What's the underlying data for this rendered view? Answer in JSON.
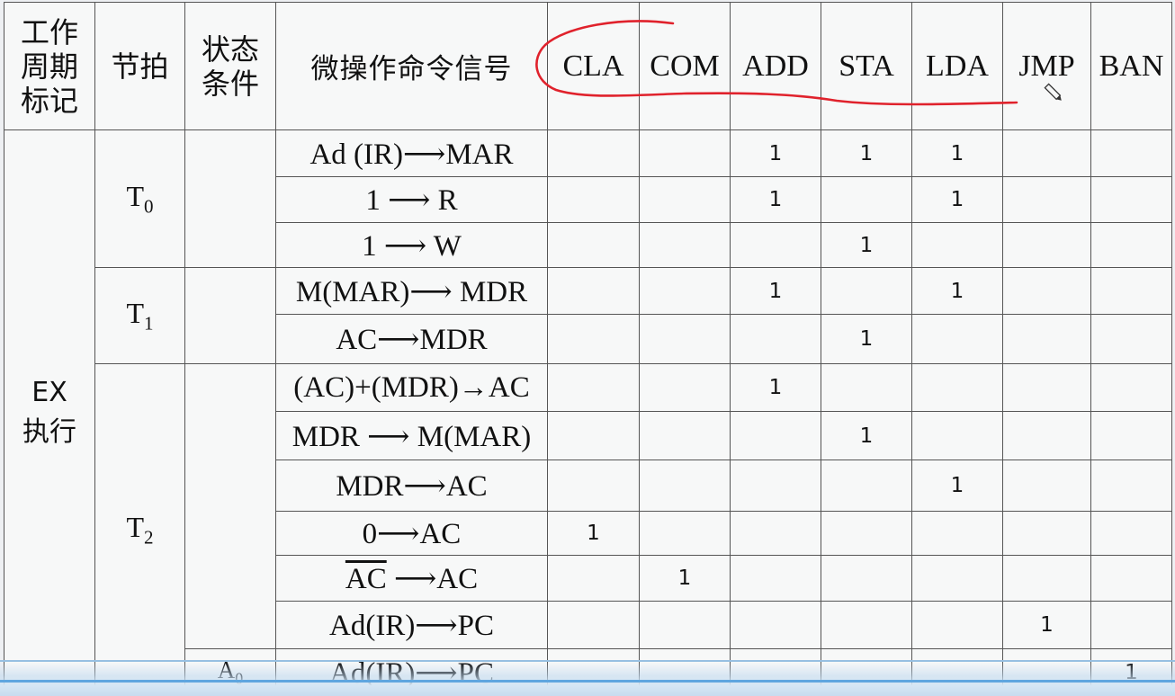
{
  "header": {
    "cycle_label": "工作\n周期\n标记",
    "beat_label": "节拍",
    "condition_label": "状态\n条件",
    "signal_label": "微操作命令信号",
    "ops": [
      "CLA",
      "COM",
      "ADD",
      "STA",
      "LDA",
      "JMP",
      "BAN"
    ]
  },
  "stage_label": "EX\n执行",
  "beats": {
    "t0": {
      "main": "T",
      "sub": "0"
    },
    "t1": {
      "main": "T",
      "sub": "1"
    },
    "t2": {
      "main": "T",
      "sub": "2"
    }
  },
  "condition_a0": {
    "main": "A",
    "sub": "0"
  },
  "rows": [
    {
      "signal": "Ad (IR)⟶MAR",
      "marks": [
        "",
        "",
        "1",
        "1",
        "1",
        "",
        ""
      ]
    },
    {
      "signal": "1 ⟶ R",
      "marks": [
        "",
        "",
        "1",
        "",
        "1",
        "",
        ""
      ]
    },
    {
      "signal": "1 ⟶ W",
      "marks": [
        "",
        "",
        "",
        "1",
        "",
        "",
        ""
      ]
    },
    {
      "signal": "M(MAR)⟶ MDR",
      "marks": [
        "",
        "",
        "1",
        "",
        "1",
        "",
        ""
      ]
    },
    {
      "signal": "AC⟶MDR",
      "marks": [
        "",
        "",
        "",
        "1",
        "",
        "",
        ""
      ]
    },
    {
      "signal": "(AC)+(MDR)→AC",
      "marks": [
        "",
        "",
        "1",
        "",
        "",
        "",
        ""
      ]
    },
    {
      "signal": "MDR ⟶ M(MAR)",
      "marks": [
        "",
        "",
        "",
        "1",
        "",
        "",
        ""
      ]
    },
    {
      "signal": "MDR⟶AC",
      "marks": [
        "",
        "",
        "",
        "",
        "1",
        "",
        ""
      ]
    },
    {
      "signal": "0⟶AC",
      "marks": [
        "1",
        "",
        "",
        "",
        "",
        "",
        ""
      ]
    },
    {
      "signal_over": "AC",
      "signal_rest": " ⟶AC",
      "marks": [
        "",
        "1",
        "",
        "",
        "",
        "",
        ""
      ]
    },
    {
      "signal": "Ad(IR)⟶PC",
      "marks": [
        "",
        "",
        "",
        "",
        "",
        "1",
        ""
      ]
    },
    {
      "signal": "Ad(IR)⟶PC",
      "marks": [
        "",
        "",
        "",
        "",
        "",
        "",
        "1"
      ]
    }
  ],
  "annotation": {
    "stroke_color": "#e0222c",
    "pencil_icon": "pencil-icon"
  }
}
